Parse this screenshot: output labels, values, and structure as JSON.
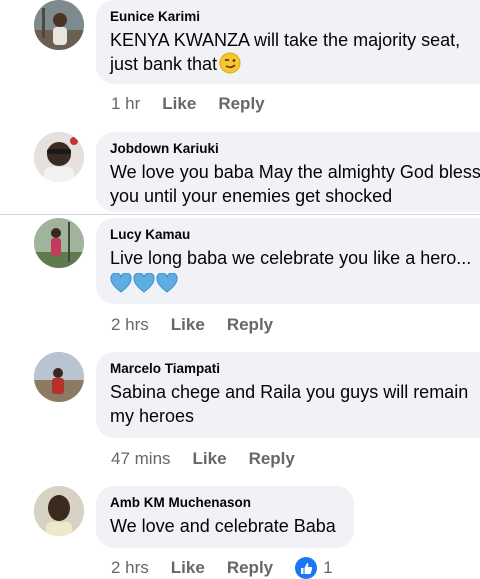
{
  "comments": [
    {
      "author": "Eunice Karimi",
      "text_line1": "KENYA KWANZA will take the majority seat,",
      "text_line2": "just bank that",
      "emoji": "smirk-wink-emoji",
      "time": "1 hr",
      "like_label": "Like",
      "reply_label": "Reply"
    },
    {
      "author": "Jobdown Kariuki",
      "text_line1": "We love you baba May the almighty God bless",
      "text_line2": "you until your enemies get shocked"
    },
    {
      "author": "Lucy Kamau",
      "text_line1": "Live long baba we celebrate you like a hero...",
      "emoji": "blue-heart-emoji x3",
      "time": "2 hrs",
      "like_label": "Like",
      "reply_label": "Reply"
    },
    {
      "author": "Marcelo Tiampati",
      "text_line1": "Sabina chege and Raila you guys will remain",
      "text_line2": "my heroes",
      "time": "47 mins",
      "like_label": "Like",
      "reply_label": "Reply"
    },
    {
      "author": "Amb KM Muchenason",
      "text_line1": "We love and celebrate Baba",
      "time": "2 hrs",
      "like_label": "Like",
      "reply_label": "Reply",
      "reaction_icon": "thumbs-up-icon",
      "reaction_count": "1"
    }
  ],
  "colors": {
    "bubble": "#f0f2f5",
    "meta_text": "#65676b",
    "like_blue": "#1877f2",
    "heart_blue": "#5dade2"
  }
}
